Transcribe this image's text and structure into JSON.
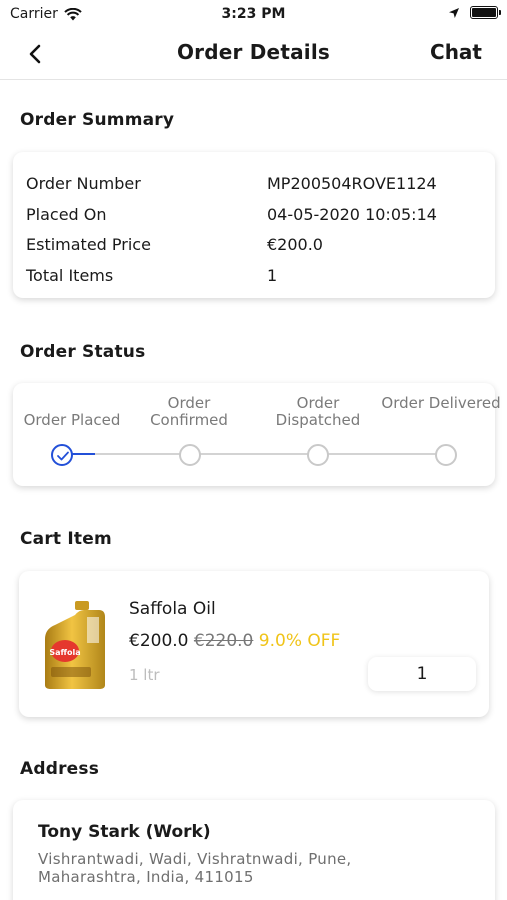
{
  "status_bar": {
    "carrier": "Carrier",
    "time": "3:23 PM"
  },
  "header": {
    "title": "Order Details",
    "chat_label": "Chat"
  },
  "sections": {
    "summary_title": "Order Summary",
    "status_title": "Order Status",
    "cart_title": "Cart Item",
    "address_title": "Address"
  },
  "order_summary": {
    "rows": [
      {
        "label": "Order Number",
        "value": "MP200504ROVE1124"
      },
      {
        "label": "Placed On",
        "value": "04-05-2020 10:05:14"
      },
      {
        "label": "Estimated Price",
        "value": "€200.0"
      },
      {
        "label": "Total Items",
        "value": "1"
      }
    ]
  },
  "order_status": {
    "steps": [
      {
        "label": "Order Placed",
        "done": true
      },
      {
        "label": "Order Confirmed",
        "done": false
      },
      {
        "label": "Order Dispatched",
        "done": false
      },
      {
        "label": "Order Delivered",
        "done": false
      }
    ],
    "colors": {
      "done": "#2350d8",
      "pending": "#c9c9c9"
    }
  },
  "cart_item": {
    "name": "Saffola Oil",
    "price": "€200.0",
    "mrp": "€220.0",
    "discount": "9.0% OFF",
    "unit": "1 ltr",
    "quantity": "1",
    "image_label": "Saffola",
    "icon": "oil-bottle-product-image"
  },
  "address": {
    "name": "Tony Stark  (Work)",
    "line": "Vishrantwadi, Wadi, Vishratnwadi, Pune, Maharashtra, India, 411015"
  }
}
